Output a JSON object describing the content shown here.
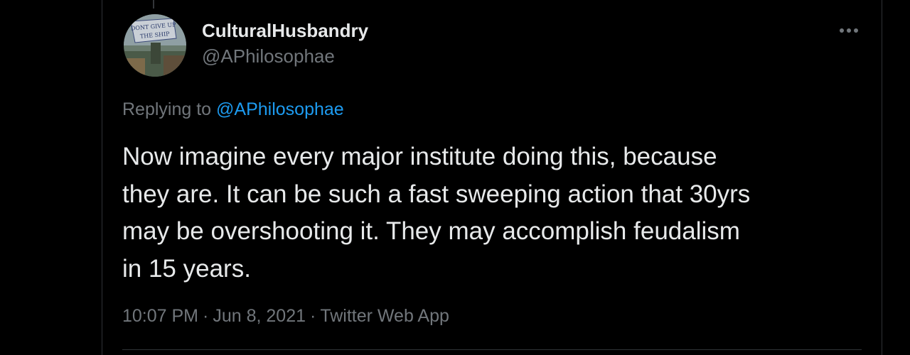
{
  "tweet": {
    "author": {
      "display_name": "CulturalHusbandry",
      "handle": "@APhilosophae",
      "avatar_banner_text": [
        "DONT GIVE UP",
        "THE SHIP"
      ]
    },
    "more_icon": "more-horizontal-icon",
    "replying": {
      "prefix": "Replying to",
      "mention": "@APhilosophae"
    },
    "text_lines": [
      "Now imagine every major institute doing this, because",
      "they are. It can be such a fast sweeping action that 30yrs",
      "may be overshooting it. They may accomplish feudalism",
      "in 15 years."
    ],
    "meta": {
      "time": "10:07 PM",
      "separator": "·",
      "date": "Jun 8, 2021",
      "source": "Twitter Web App"
    }
  },
  "colors": {
    "background": "#000000",
    "text": "#e7e9ea",
    "muted": "#71767b",
    "accent": "#1d9bf0",
    "border": "#2f3336"
  }
}
